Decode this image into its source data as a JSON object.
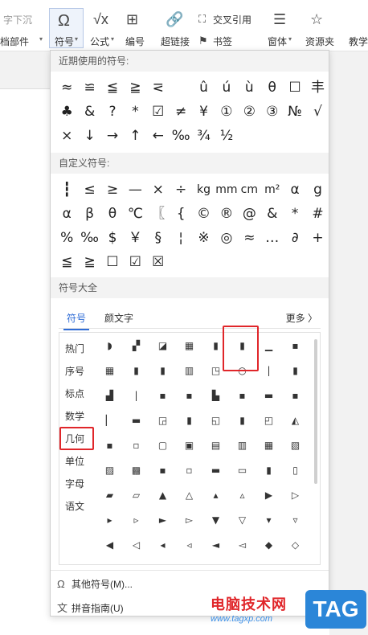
{
  "ribbon": {
    "left_top": "字下沉",
    "left_bottom": "档部件",
    "symbol": "符号",
    "formula": "公式",
    "number": "编号",
    "hyperlink": "超链接",
    "crossref": "交叉引用",
    "bookmark": "书签",
    "window": "窗体",
    "resource": "资源夹",
    "teach": "教学"
  },
  "recent_header": "近期使用的符号:",
  "recent_rows": [
    [
      "≈",
      "≌",
      "≦",
      "≧",
      "⋜",
      "",
      "û",
      "ú",
      "ù",
      "θ",
      "☐",
      "丰"
    ],
    [
      "♣",
      "&",
      "?",
      "*",
      "☑",
      "≠",
      "¥",
      "①",
      "②",
      "③",
      "№",
      "√"
    ],
    [
      "×",
      "↓",
      "→",
      "↑",
      "←",
      "‰",
      "¾",
      "½"
    ]
  ],
  "custom_header": "自定义符号:",
  "custom_rows": [
    [
      "┇",
      "≤",
      "≥",
      "—",
      "×",
      "÷",
      "kg",
      "mm",
      "cm",
      "m²",
      "α",
      "g"
    ],
    [
      "α",
      "β",
      "θ",
      "℃",
      "〖",
      "{",
      "©",
      "®",
      "@",
      "&",
      "*",
      "#"
    ],
    [
      "%",
      "‰",
      "$",
      "￥",
      "§",
      "¦",
      "※",
      "◎",
      "≈",
      "…",
      "∂",
      "+"
    ],
    [
      "≦",
      "≧",
      "☐",
      "☑",
      "☒"
    ]
  ],
  "all_header": "符号大全",
  "tabs": {
    "symbols": "符号",
    "kaomoji": "颜文字",
    "more": "更多 〉"
  },
  "categories": [
    "热门",
    "序号",
    "标点",
    "数学",
    "几何",
    "单位",
    "字母",
    "语文"
  ],
  "grid": [
    [
      "◗",
      "▞",
      "◪",
      "▦",
      "▮",
      "▮",
      "▁",
      "▪"
    ],
    [
      "▦",
      "▮",
      "▮",
      "▥",
      "◳",
      "○",
      "|",
      "▮"
    ],
    [
      "▟",
      "|",
      "▪",
      "▪",
      "▙",
      "▪",
      "▬",
      "▪"
    ],
    [
      "▏",
      "▬",
      "◲",
      "▮",
      "◱",
      "▮",
      "◰",
      "◭"
    ],
    [
      "▪",
      "▫",
      "▢",
      "▣",
      "▤",
      "▥",
      "▦",
      "▧"
    ],
    [
      "▨",
      "▩",
      "▪",
      "▫",
      "▬",
      "▭",
      "▮",
      "▯"
    ],
    [
      "▰",
      "▱",
      "▲",
      "△",
      "▴",
      "▵",
      "▶",
      "▷"
    ],
    [
      "▸",
      "▹",
      "►",
      "▻",
      "▼",
      "▽",
      "▾",
      "▿"
    ],
    [
      "◀",
      "◁",
      "◂",
      "◃",
      "◄",
      "◅",
      "◆",
      "◇"
    ]
  ],
  "other_symbols": "其他符号(M)...",
  "pinyin_guide": "拼音指南(U)",
  "watermark_title": "电脑技术网",
  "watermark_url": "www.tagxp.com",
  "tag_logo": "TAG",
  "colors": {
    "accent": "#2f6cd6",
    "highlight": "#e0262a",
    "tag_bg": "#2b86d8"
  }
}
